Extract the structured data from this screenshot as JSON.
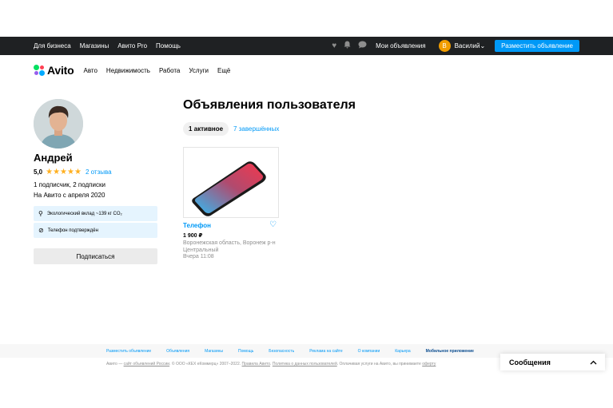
{
  "topbar": {
    "links": [
      "Для бизнеса",
      "Магазины",
      "Авито Pro",
      "Помощь"
    ],
    "icons": [
      "heart-icon",
      "bell-icon",
      "chat-icon"
    ],
    "my_ads": "Мои объявления",
    "avatar_letter": "В",
    "user_name": "Василий",
    "post_button": "Разместить объявление",
    "accent_color": "#0099f7"
  },
  "nav": {
    "logo": "Avito",
    "items": [
      "Авто",
      "Недвижимость",
      "Работа",
      "Услуги",
      "Ещё"
    ]
  },
  "profile": {
    "name": "Андрей",
    "rating": "5,0",
    "stars": "★★★★★",
    "reviews": "2 отзыва",
    "subscribers": "1 подписчик, 2 подписки",
    "since": "На Авито с апреля 2020",
    "eco": "Экологический вклад ~139 кг CO₂",
    "phone_verified": "Телефон подтверждён",
    "subscribe_button": "Подписаться"
  },
  "listings": {
    "heading": "Объявления пользователя",
    "tab_active": "1 активное",
    "tab_completed": "7 завершённых",
    "items": [
      {
        "title": "Телефон",
        "price": "1 900 ₽",
        "location": "Воронежская область, Воронеж р-н Центральный",
        "time": "Вчера 11:08"
      }
    ]
  },
  "footer": {
    "links": [
      "Разместить объявление",
      "Объявления",
      "Магазины",
      "Помощь",
      "Безопасность",
      "Реклама на сайте",
      "О компании",
      "Карьера",
      "Мобильное приложение"
    ],
    "copy_prefix": "Авито — ",
    "copy_link1": "сайт объявлений России",
    "copy_mid": ". © ООО «КЕХ еКоммерц» 2007–2022. ",
    "copy_link2": "Правила Авито",
    "copy_sep": ". ",
    "copy_link3": "Политика о данных пользователей",
    "copy_suffix": ". Оплачивая услуги на Авито, вы принимаете ",
    "copy_link4": "оферту"
  },
  "messages": {
    "label": "Сообщения"
  }
}
